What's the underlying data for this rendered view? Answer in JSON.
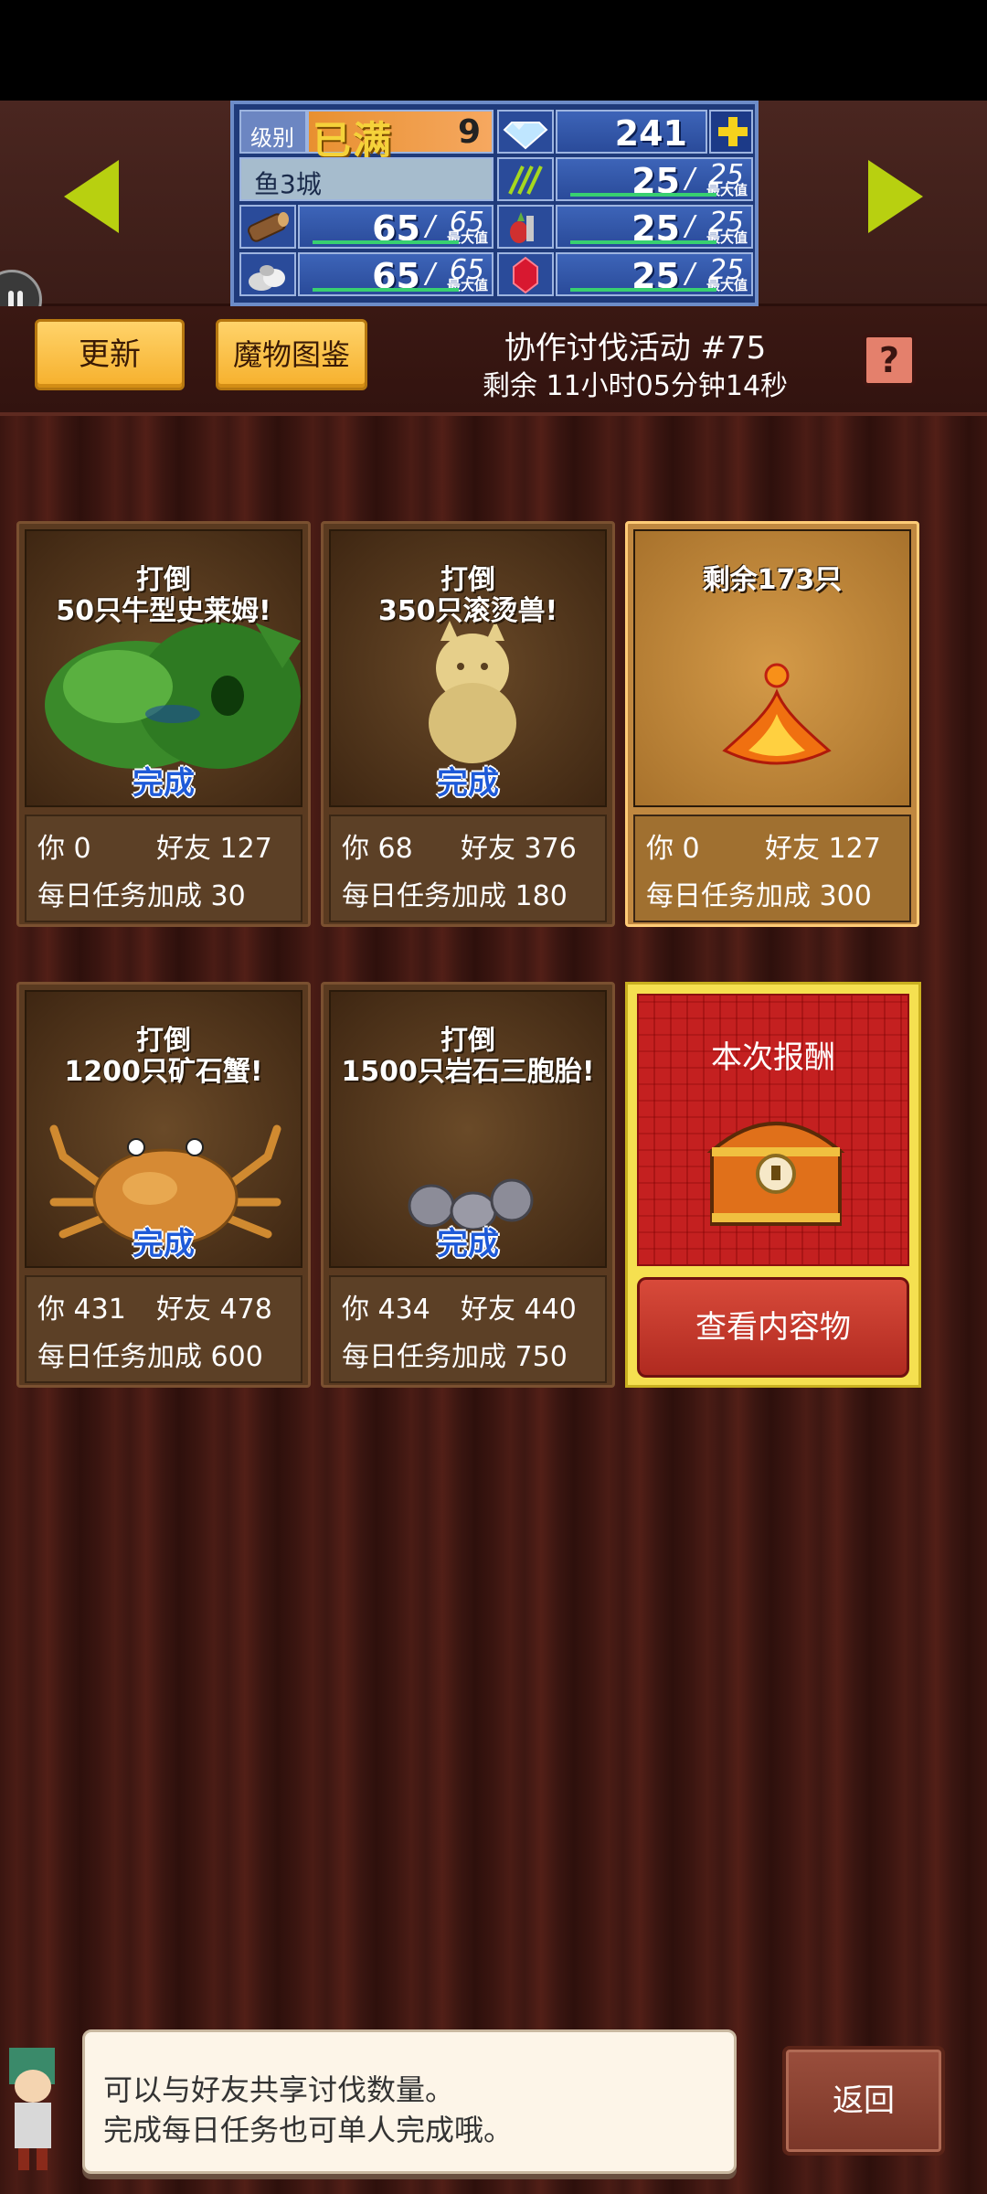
{
  "hud": {
    "level_label": "级别",
    "level_max_text": "已满",
    "level_value": "9",
    "gems": "241",
    "city_name": "鱼3城",
    "max_label": "最大值",
    "wood": {
      "current": "65",
      "max": "65"
    },
    "stone": {
      "current": "65",
      "max": "65"
    },
    "grass": {
      "current": "25",
      "max": "25"
    },
    "food": {
      "current": "25",
      "max": "25"
    },
    "ruby": {
      "current": "25",
      "max": "25"
    }
  },
  "header": {
    "update_label": "更新",
    "bestiary_label": "魔物图鉴",
    "event_title": "协作讨伐活动 #75",
    "event_remaining": "剩余 11小时05分钟14秒",
    "help_label": "?"
  },
  "cards": [
    {
      "goal_line1": "打倒",
      "goal_line2": "50只牛型史莱姆!",
      "status": "完成",
      "you_label": "你",
      "you": "0",
      "friend_label": "好友",
      "friend": "127",
      "bonus_label": "每日任务加成",
      "bonus": "30"
    },
    {
      "goal_line1": "打倒",
      "goal_line2": "350只滚烫兽!",
      "status": "完成",
      "you_label": "你",
      "you": "68",
      "friend_label": "好友",
      "friend": "376",
      "bonus_label": "每日任务加成",
      "bonus": "180"
    },
    {
      "goal_line1": "剩余173只",
      "goal_line2": "",
      "status": "",
      "you_label": "你",
      "you": "0",
      "friend_label": "好友",
      "friend": "127",
      "bonus_label": "每日任务加成",
      "bonus": "300"
    },
    {
      "goal_line1": "打倒",
      "goal_line2": "1200只矿石蟹!",
      "status": "完成",
      "you_label": "你",
      "you": "431",
      "friend_label": "好友",
      "friend": "478",
      "bonus_label": "每日任务加成",
      "bonus": "600"
    },
    {
      "goal_line1": "打倒",
      "goal_line2": "1500只岩石三胞胎!",
      "status": "完成",
      "you_label": "你",
      "you": "434",
      "friend_label": "好友",
      "friend": "440",
      "bonus_label": "每日任务加成",
      "bonus": "750"
    }
  ],
  "reward": {
    "title": "本次报酬",
    "view_button": "查看内容物"
  },
  "message": {
    "line1": "可以与好友共享讨伐数量。",
    "line2": "完成每日任务也可单人完成哦。"
  },
  "back_button": "返回"
}
